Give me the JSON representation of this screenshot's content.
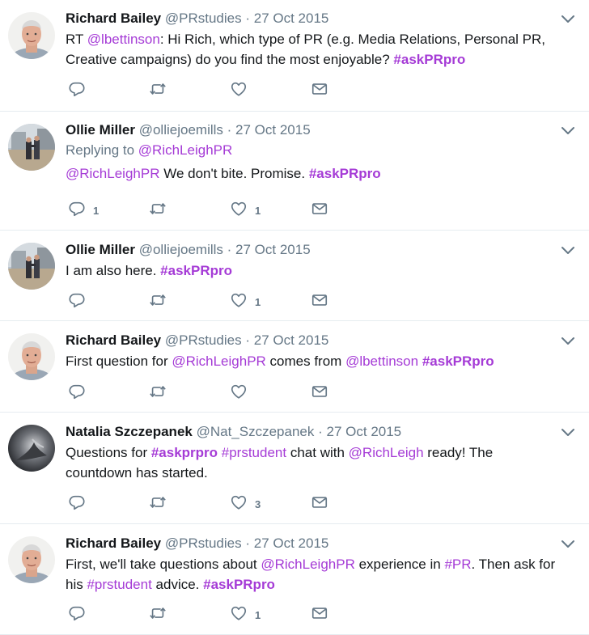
{
  "tweets": [
    {
      "author": "Richard Bailey",
      "handle": "@PRstudies",
      "date": "27 Oct 2015",
      "avatar": "richard",
      "replying": null,
      "lines": [
        [
          [
            "t",
            "RT "
          ],
          [
            "l",
            "@lbettinson"
          ],
          [
            "t",
            ": Hi Rich, which type of PR (e.g. Media Relations, Personal PR,"
          ]
        ],
        [
          [
            "t",
            "Creative campaigns) do you find the most enjoyable? "
          ],
          [
            "h",
            "#askPRpro"
          ]
        ]
      ],
      "counts": {
        "reply": "",
        "retweet": "",
        "like": ""
      }
    },
    {
      "author": "Ollie Miller",
      "handle": "@olliejoemills",
      "date": "27 Oct 2015",
      "avatar": "ollie",
      "replying": {
        "prefix": "Replying to ",
        "handle": "@RichLeighPR"
      },
      "lines": [
        [
          [
            "l",
            "@RichLeighPR"
          ],
          [
            "t",
            " We don't bite. Promise. "
          ],
          [
            "h",
            "#askPRpro"
          ]
        ]
      ],
      "counts": {
        "reply": "1",
        "retweet": "",
        "like": "1"
      }
    },
    {
      "author": "Ollie Miller",
      "handle": "@olliejoemills",
      "date": "27 Oct 2015",
      "avatar": "ollie",
      "replying": null,
      "lines": [
        [
          [
            "t",
            "I am also here. "
          ],
          [
            "h",
            "#askPRpro"
          ]
        ]
      ],
      "counts": {
        "reply": "",
        "retweet": "",
        "like": "1"
      }
    },
    {
      "author": "Richard Bailey",
      "handle": "@PRstudies",
      "date": "27 Oct 2015",
      "avatar": "richard",
      "replying": null,
      "lines": [
        [
          [
            "t",
            "First question for "
          ],
          [
            "l",
            "@RichLeighPR"
          ],
          [
            "t",
            " comes from "
          ],
          [
            "l",
            "@lbettinson"
          ],
          [
            "t",
            " "
          ],
          [
            "h",
            "#askPRpro"
          ]
        ]
      ],
      "counts": {
        "reply": "",
        "retweet": "",
        "like": ""
      }
    },
    {
      "author": "Natalia Szczepanek",
      "handle": "@Nat_Szczepanek",
      "date": "27 Oct 2015",
      "avatar": "natalia",
      "replying": null,
      "lines": [
        [
          [
            "t",
            "Questions for "
          ],
          [
            "h",
            "#askprpro"
          ],
          [
            "t",
            " "
          ],
          [
            "l",
            "#prstudent"
          ],
          [
            "t",
            " chat with "
          ],
          [
            "l",
            "@RichLeigh"
          ],
          [
            "t",
            " ready! The"
          ]
        ],
        [
          [
            "t",
            "countdown has started."
          ]
        ]
      ],
      "counts": {
        "reply": "",
        "retweet": "",
        "like": "3"
      }
    },
    {
      "author": "Richard Bailey",
      "handle": "@PRstudies",
      "date": "27 Oct 2015",
      "avatar": "richard",
      "replying": null,
      "lines": [
        [
          [
            "t",
            "First, we'll take questions about "
          ],
          [
            "l",
            "@RichLeighPR"
          ],
          [
            "t",
            " experience in "
          ],
          [
            "l",
            "#PR"
          ],
          [
            "t",
            ". Then ask for"
          ]
        ],
        [
          [
            "t",
            "his "
          ],
          [
            "l",
            "#prstudent"
          ],
          [
            "t",
            " advice. "
          ],
          [
            "h",
            "#askPRpro"
          ]
        ]
      ],
      "counts": {
        "reply": "",
        "retweet": "",
        "like": "1"
      }
    }
  ],
  "ui": {
    "dot": "·",
    "icons": {
      "reply": "reply-icon",
      "retweet": "retweet-icon",
      "like": "heart-icon",
      "dm": "envelope-icon",
      "menu": "chevron-down-icon"
    },
    "colors": {
      "link": "#a53bd6",
      "muted": "#657786",
      "divider": "#e6ecf0",
      "text": "#14171a"
    }
  }
}
